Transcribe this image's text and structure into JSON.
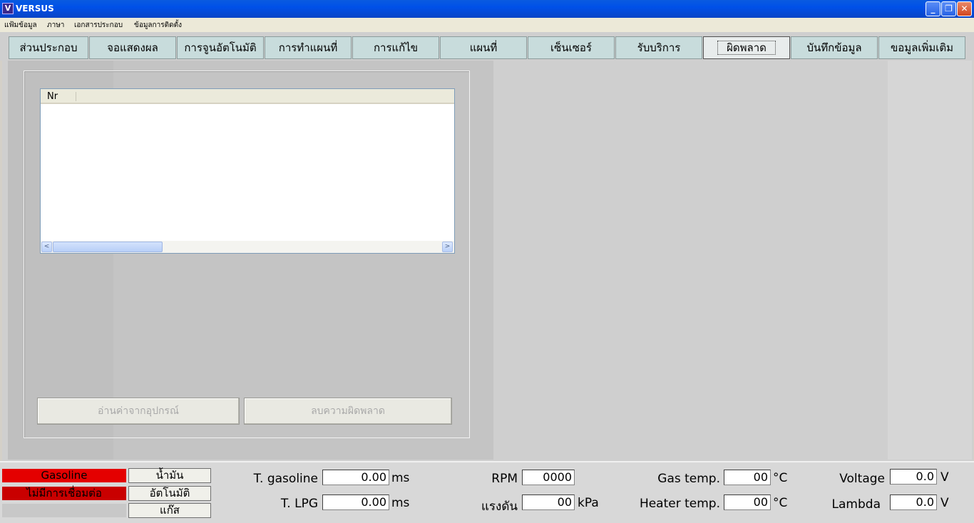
{
  "window": {
    "title": "VERSUS",
    "icon_letter": "V",
    "minimize_glyph": "_",
    "restore_glyph": "❐",
    "close_glyph": "✕"
  },
  "menu": [
    "แฟ้มข้อมูล",
    "ภาษา",
    "เอกสารประกอบ",
    "ข้อมูลการติดตั้ง"
  ],
  "tabs": [
    "ส่วนประกอบ",
    "จอแสดงผล",
    "การจูนอัตโนมัติ",
    "การทำแผนที่",
    "การแก้ไข",
    "แผนที่",
    "เซ็นเซอร์",
    "รับบริการ",
    "ผิดพลาด",
    "บันทึกข้อมูล",
    "ขอมูลเพิ่มเติม"
  ],
  "active_tab": "ผิดพลาด",
  "errors_list": {
    "columns": [
      "Nr"
    ],
    "scroll_left_glyph": "<",
    "scroll_right_glyph": ">"
  },
  "buttons": {
    "read_device": "อ่านค่าจากอุปกรณ์",
    "clear_errors": "ลบความผิดพลาด"
  },
  "status": {
    "fuel_gasoline": "Gasoline",
    "connection": "ไม่มีการเชื่อมต่อ",
    "mode_petrol": "น้ำมัน",
    "mode_auto": "อัตโนมัติ",
    "mode_gas": "แก๊ส",
    "t_gasoline": {
      "label": "T. gasoline",
      "value": "0.00",
      "unit": "ms"
    },
    "t_lpg": {
      "label": "T. LPG",
      "value": "0.00",
      "unit": "ms"
    },
    "rpm": {
      "label": "RPM",
      "value": "0000"
    },
    "pressure": {
      "label": "แรงดัน",
      "value": "00",
      "unit": "kPa"
    },
    "gas_temp": {
      "label": "Gas temp.",
      "value": "00",
      "unit": "°C"
    },
    "heater_temp": {
      "label": "Heater temp.",
      "value": "00",
      "unit": "°C"
    },
    "voltage": {
      "label": "Voltage",
      "value": "0.0",
      "unit": "V"
    },
    "lambda": {
      "label": "Lambda",
      "value": "0.0",
      "unit": "V"
    }
  },
  "colors": {
    "title_bar": "#0050e8",
    "fuel_indicator": "#e40000",
    "connection_indicator": "#c90000",
    "tab_background": "#c8dcdc"
  }
}
